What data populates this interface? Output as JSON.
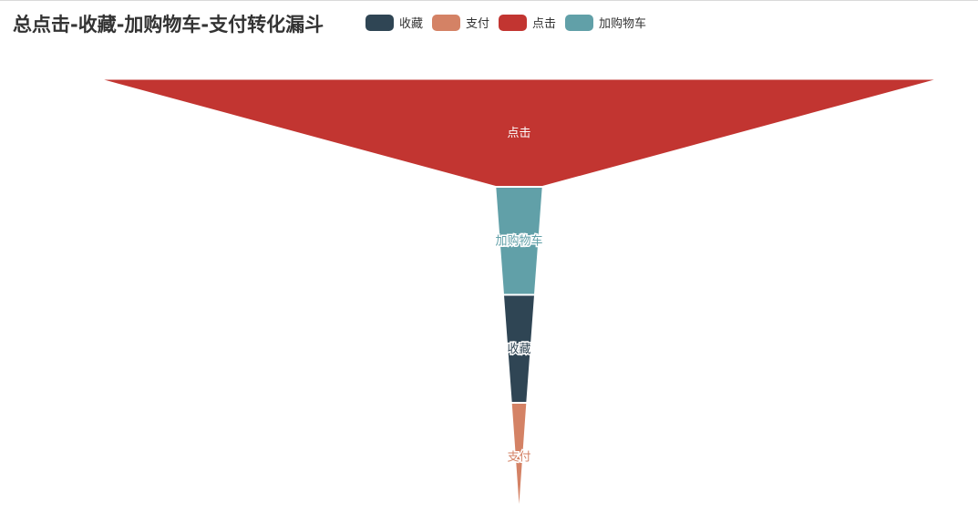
{
  "title": "总点击-收藏-加购物车-支付转化漏斗",
  "legend": [
    {
      "label": "收藏",
      "color": "#2f4554"
    },
    {
      "label": "支付",
      "color": "#d48265"
    },
    {
      "label": "点击",
      "color": "#c23531"
    },
    {
      "label": "加购物车",
      "color": "#61a0a8"
    }
  ],
  "chart_data": {
    "type": "funnel",
    "title": "总点击-收藏-加购物车-支付转化漏斗",
    "sort": "descending",
    "series": [
      {
        "name": "点击",
        "value": 100,
        "color": "#c23531"
      },
      {
        "name": "加购物车",
        "value": 5.6,
        "color": "#61a0a8"
      },
      {
        "name": "收藏",
        "value": 3.7,
        "color": "#2f4554"
      },
      {
        "name": "支付",
        "value": 1.8,
        "color": "#d48265"
      }
    ],
    "legend_position": "top"
  }
}
